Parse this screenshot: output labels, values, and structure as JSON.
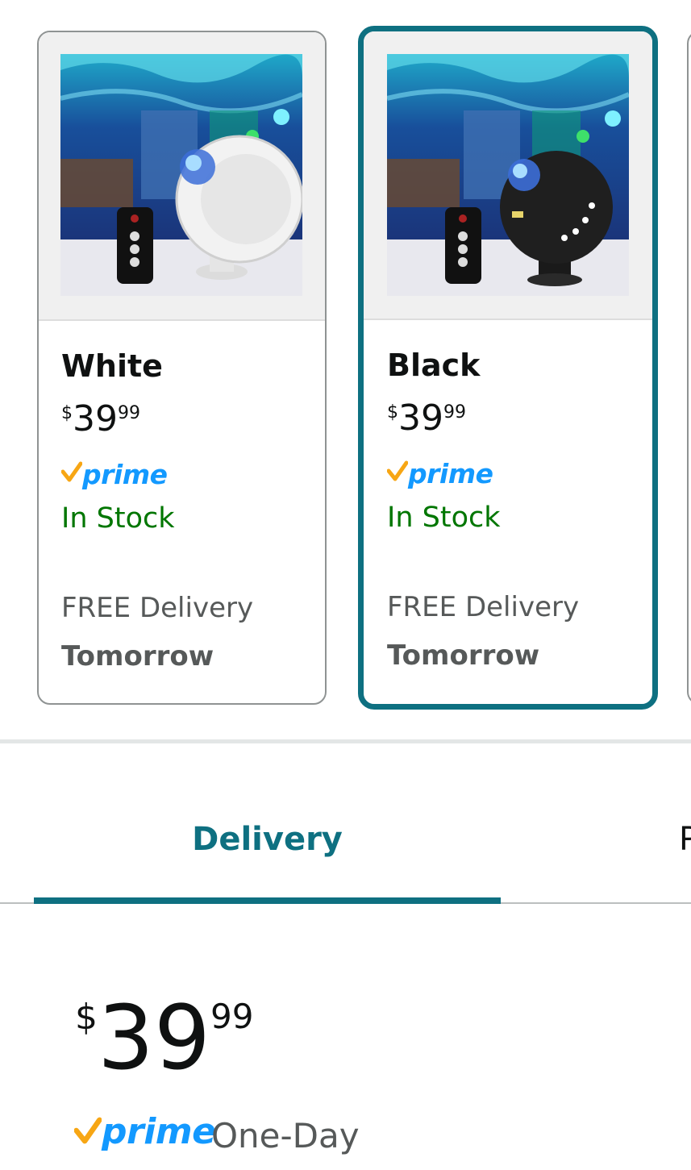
{
  "swatches": [
    {
      "name": "White",
      "price_symbol": "$",
      "price_whole": "39",
      "price_fraction": "99",
      "prime_label": "prime",
      "stock": "In Stock",
      "delivery_line1": "FREE Delivery",
      "delivery_line2": "Tomorrow",
      "selected": false,
      "device_color": "#f2f2f2"
    },
    {
      "name": "Black",
      "price_symbol": "$",
      "price_whole": "39",
      "price_fraction": "99",
      "prime_label": "prime",
      "stock": "In Stock",
      "delivery_line1": "FREE Delivery",
      "delivery_line2": "Tomorrow",
      "selected": true,
      "device_color": "#1f1f1f"
    }
  ],
  "tabs": {
    "active_label": "Delivery",
    "next_label_partial": "P"
  },
  "buybox": {
    "price_symbol": "$",
    "price_whole": "39",
    "price_fraction": "99",
    "prime_label": "prime",
    "shipping_speed": "One-Day"
  },
  "colors": {
    "accent_teal": "#0e7081",
    "stock_green": "#007600",
    "prime_blue": "#1399ff",
    "prime_check": "#f7a614"
  }
}
